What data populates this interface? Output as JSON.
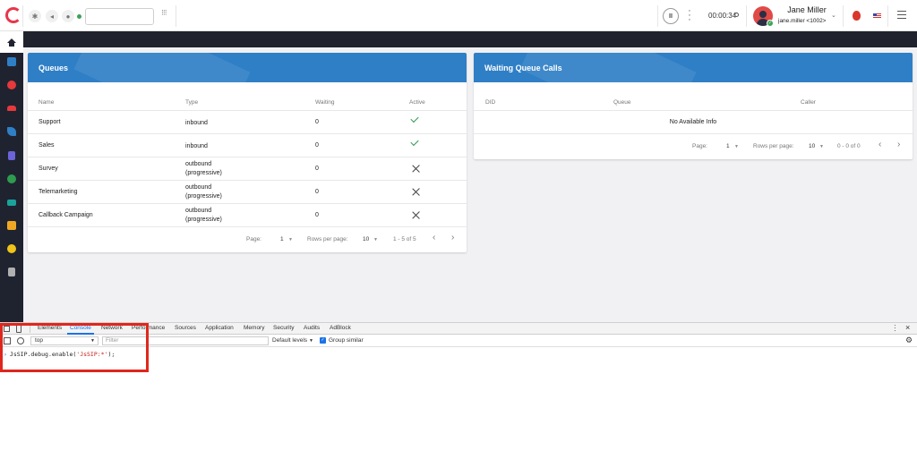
{
  "topbar": {
    "dial_placeholder": "",
    "timer": "00:00:34",
    "user_name": "Jane Miller",
    "user_ext": "jane.miller <1002>",
    "icons": [
      "logo-icon",
      "bug-icon",
      "volume-icon",
      "mic-icon",
      "dialpad-icon",
      "pause-icon",
      "kebab-icon",
      "avatar",
      "fire-icon",
      "us-flag-icon",
      "menu-icon"
    ]
  },
  "sidebar": {
    "items": [
      {
        "icon": "home-icon",
        "color": "#1f2330",
        "active": true
      },
      {
        "icon": "dashboard-icon",
        "color": "#2f7fc6"
      },
      {
        "icon": "contact-icon",
        "color": "#e5393c"
      },
      {
        "icon": "users-icon",
        "color": "#e5393c"
      },
      {
        "icon": "phone-icon",
        "color": "#2f7fc6"
      },
      {
        "icon": "clipboard-icon",
        "color": "#6b63d8"
      },
      {
        "icon": "chat-icon",
        "color": "#2e9b4f"
      },
      {
        "icon": "mail-icon",
        "color": "#1aa39a"
      },
      {
        "icon": "message-icon",
        "color": "#f0a823"
      },
      {
        "icon": "sync-icon",
        "color": "#f0c419"
      },
      {
        "icon": "calculator-icon",
        "color": "#b0b0b0"
      }
    ]
  },
  "queues": {
    "title": "Queues",
    "columns": [
      "Name",
      "Type",
      "Waiting",
      "Active"
    ],
    "rows": [
      {
        "name": "Support",
        "type": "inbound",
        "waiting": "0",
        "active": true
      },
      {
        "name": "Sales",
        "type": "inbound",
        "waiting": "0",
        "active": true
      },
      {
        "name": "Survey",
        "type": "outbound (progressive)",
        "type_line1": "outbound",
        "type_line2": "(progressive)",
        "waiting": "0",
        "active": false
      },
      {
        "name": "Telemarketing",
        "type": "outbound (progressive)",
        "type_line1": "outbound",
        "type_line2": "(progressive)",
        "waiting": "0",
        "active": false
      },
      {
        "name": "Callback Campaign",
        "type": "outbound (progressive)",
        "type_line1": "outbound",
        "type_line2": "(progressive)",
        "waiting": "0",
        "active": false
      }
    ],
    "footer": {
      "page_label": "Page:",
      "page": "1",
      "rows_label": "Rows per page:",
      "rows": "10",
      "range": "1 - 5 of 5"
    }
  },
  "waiting": {
    "title": "Waiting Queue Calls",
    "columns": [
      "DID",
      "Queue",
      "Caller"
    ],
    "empty": "No Available Info",
    "footer": {
      "page_label": "Page:",
      "page": "1",
      "rows_label": "Rows per page:",
      "rows": "10",
      "range": "0 - 0 of 0"
    }
  },
  "devtools": {
    "tabs": [
      "Elements",
      "Console",
      "Network",
      "Performance",
      "Sources",
      "Application",
      "Memory",
      "Security",
      "Audits",
      "AdBlock"
    ],
    "active_tab": "Console",
    "context": "top",
    "filter_placeholder": "Filter",
    "levels": "Default levels",
    "group_similar": "Group similar",
    "command_prefix": "JsSIP.debug.enable(",
    "command_string": "'JsSIP:*'",
    "command_suffix": ");"
  },
  "colors": {
    "accent": "#2f7fc6",
    "highlight": "#e0261c",
    "check": "#2e9b4f"
  }
}
